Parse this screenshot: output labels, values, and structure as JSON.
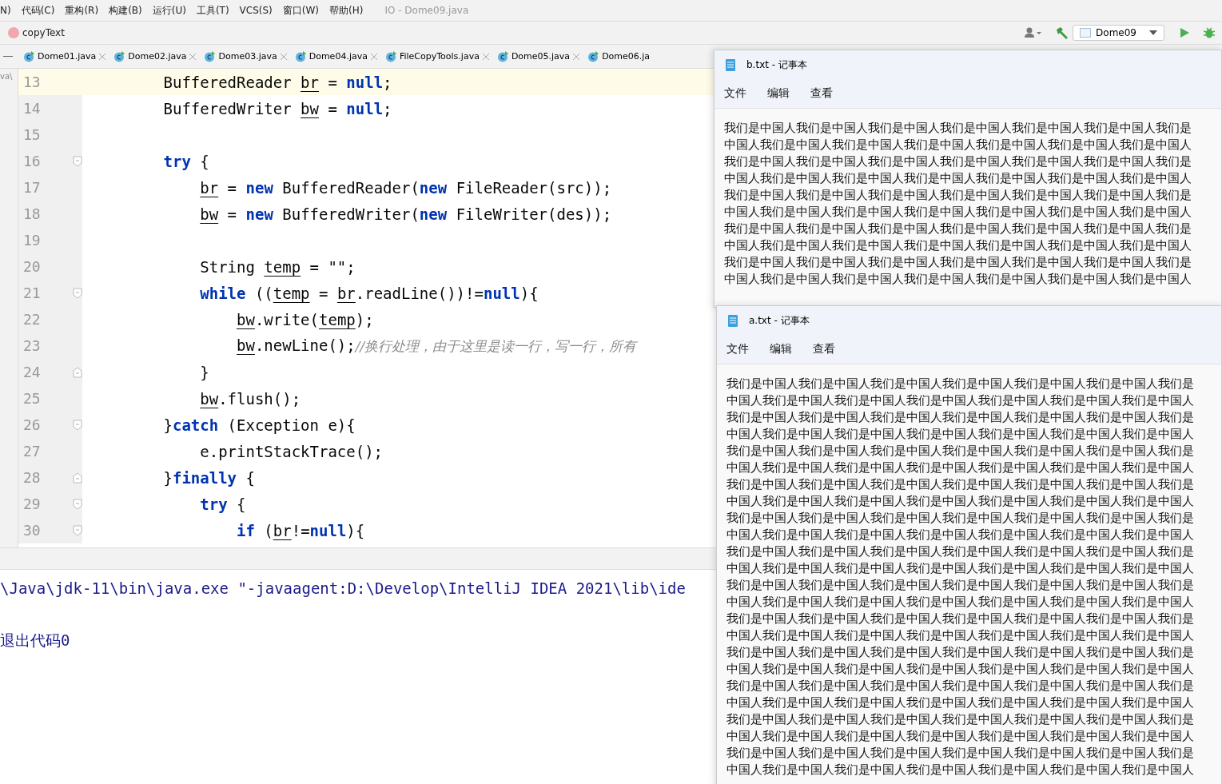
{
  "menu_bar": {
    "items": [
      "N)",
      "代码(C)",
      "重构(R)",
      "构建(B)",
      "运行(U)",
      "工具(T)",
      "VCS(S)",
      "窗口(W)",
      "帮助(H)"
    ],
    "title": "IO - Dome09.java"
  },
  "breadcrumb": {
    "method": "copyText"
  },
  "toolbar": {
    "run_config": "Dome09"
  },
  "project_panel": {
    "path": "va\\"
  },
  "tabs": [
    "Dome01.java",
    "Dome02.java",
    "Dome03.java",
    "Dome04.java",
    "FileCopyTools.java",
    "Dome05.java",
    "Dome06.ja"
  ],
  "editor": {
    "lines": [
      {
        "number": "13",
        "current": true,
        "fold_open": false,
        "fold_close": false,
        "segments": [
          {
            "kind": "plain",
            "text": "        BufferedReader "
          },
          {
            "kind": "var",
            "text": "br"
          },
          {
            "kind": "plain",
            "text": " = "
          },
          {
            "kind": "kw",
            "text": "null"
          },
          {
            "kind": "plain",
            "text": ";"
          }
        ]
      },
      {
        "number": "14",
        "current": false,
        "fold_open": false,
        "fold_close": false,
        "segments": [
          {
            "kind": "plain",
            "text": "        BufferedWriter "
          },
          {
            "kind": "var",
            "text": "bw"
          },
          {
            "kind": "plain",
            "text": " = "
          },
          {
            "kind": "kw",
            "text": "null"
          },
          {
            "kind": "plain",
            "text": ";"
          }
        ]
      },
      {
        "number": "15",
        "current": false,
        "fold_open": false,
        "fold_close": false
      },
      {
        "number": "16",
        "current": false,
        "fold_open": true,
        "fold_close": false,
        "segments": [
          {
            "kind": "kw",
            "text": "        try"
          },
          {
            "kind": "plain",
            "text": " {"
          }
        ]
      },
      {
        "number": "17",
        "current": false,
        "fold_open": false,
        "fold_close": false,
        "segments": [
          {
            "kind": "var",
            "text": "            br"
          },
          {
            "kind": "plain",
            "text": " = "
          },
          {
            "kind": "kw",
            "text": "new"
          },
          {
            "kind": "plain",
            "text": " BufferedReader("
          },
          {
            "kind": "kw",
            "text": "new"
          },
          {
            "kind": "plain",
            "text": " FileReader(src));"
          }
        ]
      },
      {
        "number": "18",
        "current": false,
        "fold_open": false,
        "fold_close": false,
        "segments": [
          {
            "kind": "var",
            "text": "            bw"
          },
          {
            "kind": "plain",
            "text": " = "
          },
          {
            "kind": "kw",
            "text": "new"
          },
          {
            "kind": "plain",
            "text": " BufferedWriter("
          },
          {
            "kind": "kw",
            "text": "new"
          },
          {
            "kind": "plain",
            "text": " FileWriter(des));"
          }
        ]
      },
      {
        "number": "19",
        "current": false,
        "fold_open": false,
        "fold_close": false
      },
      {
        "number": "20",
        "current": false,
        "fold_open": false,
        "fold_close": false,
        "segments": [
          {
            "kind": "plain",
            "text": "            String "
          },
          {
            "kind": "var",
            "text": "temp"
          },
          {
            "kind": "plain",
            "text": " = \"\";"
          }
        ]
      },
      {
        "number": "21",
        "current": false,
        "fold_open": true,
        "fold_close": false,
        "segments": [
          {
            "kind": "kw",
            "text": "            while"
          },
          {
            "kind": "plain",
            "text": " (("
          },
          {
            "kind": "var",
            "text": "temp"
          },
          {
            "kind": "plain",
            "text": " = "
          },
          {
            "kind": "var",
            "text": "br"
          },
          {
            "kind": "plain",
            "text": ".readLine())!="
          },
          {
            "kind": "kw",
            "text": "null"
          },
          {
            "kind": "plain",
            "text": "){"
          }
        ]
      },
      {
        "number": "22",
        "current": false,
        "fold_open": false,
        "fold_close": false,
        "segments": [
          {
            "kind": "var",
            "text": "                bw"
          },
          {
            "kind": "plain",
            "text": ".write("
          },
          {
            "kind": "var",
            "text": "temp"
          },
          {
            "kind": "plain",
            "text": ");"
          }
        ]
      },
      {
        "number": "23",
        "current": false,
        "fold_open": false,
        "fold_close": false,
        "segments": [
          {
            "kind": "var",
            "text": "                bw"
          },
          {
            "kind": "plain",
            "text": ".newLine();"
          },
          {
            "kind": "comment",
            "text": "//换行处理，由于这里是读一行，写一行，所有"
          }
        ]
      },
      {
        "number": "24",
        "current": false,
        "fold_open": false,
        "fold_close": true,
        "segments": [
          {
            "kind": "plain",
            "text": "            }"
          }
        ]
      },
      {
        "number": "25",
        "current": false,
        "fold_open": false,
        "fold_close": false,
        "segments": [
          {
            "kind": "var",
            "text": "            bw"
          },
          {
            "kind": "plain",
            "text": ".flush();"
          }
        ]
      },
      {
        "number": "26",
        "current": false,
        "fold_open": true,
        "fold_close": false,
        "segments": [
          {
            "kind": "plain",
            "text": "        }"
          },
          {
            "kind": "kw",
            "text": "catch"
          },
          {
            "kind": "plain",
            "text": " (Exception e){"
          }
        ]
      },
      {
        "number": "27",
        "current": false,
        "fold_open": false,
        "fold_close": false,
        "segments": [
          {
            "kind": "plain",
            "text": "            e.printStackTrace();"
          }
        ]
      },
      {
        "number": "28",
        "current": false,
        "fold_open": false,
        "fold_close": true,
        "segments": [
          {
            "kind": "plain",
            "text": "        }"
          },
          {
            "kind": "kw",
            "text": "finally"
          },
          {
            "kind": "plain",
            "text": " {"
          }
        ]
      },
      {
        "number": "29",
        "current": false,
        "fold_open": true,
        "fold_close": false,
        "segments": [
          {
            "kind": "kw",
            "text": "            try"
          },
          {
            "kind": "plain",
            "text": " {"
          }
        ]
      },
      {
        "number": "30",
        "current": false,
        "fold_open": true,
        "fold_close": false,
        "segments": [
          {
            "kind": "kw",
            "text": "                if"
          },
          {
            "kind": "plain",
            "text": " ("
          },
          {
            "kind": "var",
            "text": "br"
          },
          {
            "kind": "plain",
            "text": "!="
          },
          {
            "kind": "kw",
            "text": "null"
          },
          {
            "kind": "plain",
            "text": "){"
          }
        ]
      }
    ]
  },
  "console": {
    "lines": [
      "\\Java\\jdk-11\\bin\\java.exe \"-javaagent:D:\\Develop\\IntelliJ IDEA 2021\\lib\\ide",
      "退出代码0"
    ]
  },
  "notepads": [
    {
      "title": "b.txt - 记事本",
      "menu": [
        "文件",
        "编辑",
        "查看"
      ],
      "lines": [
        "我们是中国人我们是中国人我们是中国人我们是中国人我们是中国人我们是中国人我们是",
        "中国人我们是中国人我们是中国人我们是中国人我们是中国人我们是中国人我们是中国人",
        "我们是中国人我们是中国人我们是中国人我们是中国人我们是中国人我们是中国人我们是",
        "中国人我们是中国人我们是中国人我们是中国人我们是中国人我们是中国人我们是中国人",
        "我们是中国人我们是中国人我们是中国人我们是中国人我们是中国人我们是中国人我们是",
        "中国人我们是中国人我们是中国人我们是中国人我们是中国人我们是中国人我们是中国人",
        "我们是中国人我们是中国人我们是中国人我们是中国人我们是中国人我们是中国人我们是",
        "中国人我们是中国人我们是中国人我们是中国人我们是中国人我们是中国人我们是中国人",
        "我们是中国人我们是中国人我们是中国人我们是中国人我们是中国人我们是中国人我们是",
        "中国人我们是中国人我们是中国人我们是中国人我们是中国人我们是中国人我们是中国人"
      ]
    },
    {
      "title": "a.txt - 记事本",
      "menu": [
        "文件",
        "编辑",
        "查看"
      ],
      "lines": [
        "我们是中国人我们是中国人我们是中国人我们是中国人我们是中国人我们是中国人我们是",
        "中国人我们是中国人我们是中国人我们是中国人我们是中国人我们是中国人我们是中国人",
        "我们是中国人我们是中国人我们是中国人我们是中国人我们是中国人我们是中国人我们是",
        "中国人我们是中国人我们是中国人我们是中国人我们是中国人我们是中国人我们是中国人",
        "我们是中国人我们是中国人我们是中国人我们是中国人我们是中国人我们是中国人我们是",
        "中国人我们是中国人我们是中国人我们是中国人我们是中国人我们是中国人我们是中国人",
        "我们是中国人我们是中国人我们是中国人我们是中国人我们是中国人我们是中国人我们是",
        "中国人我们是中国人我们是中国人我们是中国人我们是中国人我们是中国人我们是中国人",
        "我们是中国人我们是中国人我们是中国人我们是中国人我们是中国人我们是中国人我们是",
        "中国人我们是中国人我们是中国人我们是中国人我们是中国人我们是中国人我们是中国人",
        "我们是中国人我们是中国人我们是中国人我们是中国人我们是中国人我们是中国人我们是",
        "中国人我们是中国人我们是中国人我们是中国人我们是中国人我们是中国人我们是中国人",
        "我们是中国人我们是中国人我们是中国人我们是中国人我们是中国人我们是中国人我们是",
        "中国人我们是中国人我们是中国人我们是中国人我们是中国人我们是中国人我们是中国人",
        "我们是中国人我们是中国人我们是中国人我们是中国人我们是中国人我们是中国人我们是",
        "中国人我们是中国人我们是中国人我们是中国人我们是中国人我们是中国人我们是中国人",
        "我们是中国人我们是中国人我们是中国人我们是中国人我们是中国人我们是中国人我们是",
        "中国人我们是中国人我们是中国人我们是中国人我们是中国人我们是中国人我们是中国人",
        "我们是中国人我们是中国人我们是中国人我们是中国人我们是中国人我们是中国人我们是",
        "中国人我们是中国人我们是中国人我们是中国人我们是中国人我们是中国人我们是中国人",
        "我们是中国人我们是中国人我们是中国人我们是中国人我们是中国人我们是中国人我们是",
        "中国人我们是中国人我们是中国人我们是中国人我们是中国人我们是中国人我们是中国人",
        "我们是中国人我们是中国人我们是中国人我们是中国人我们是中国人我们是中国人我们是",
        "中国人我们是中国人我们是中国人我们是中国人我们是中国人我们是中国人我们是中国人"
      ]
    }
  ]
}
